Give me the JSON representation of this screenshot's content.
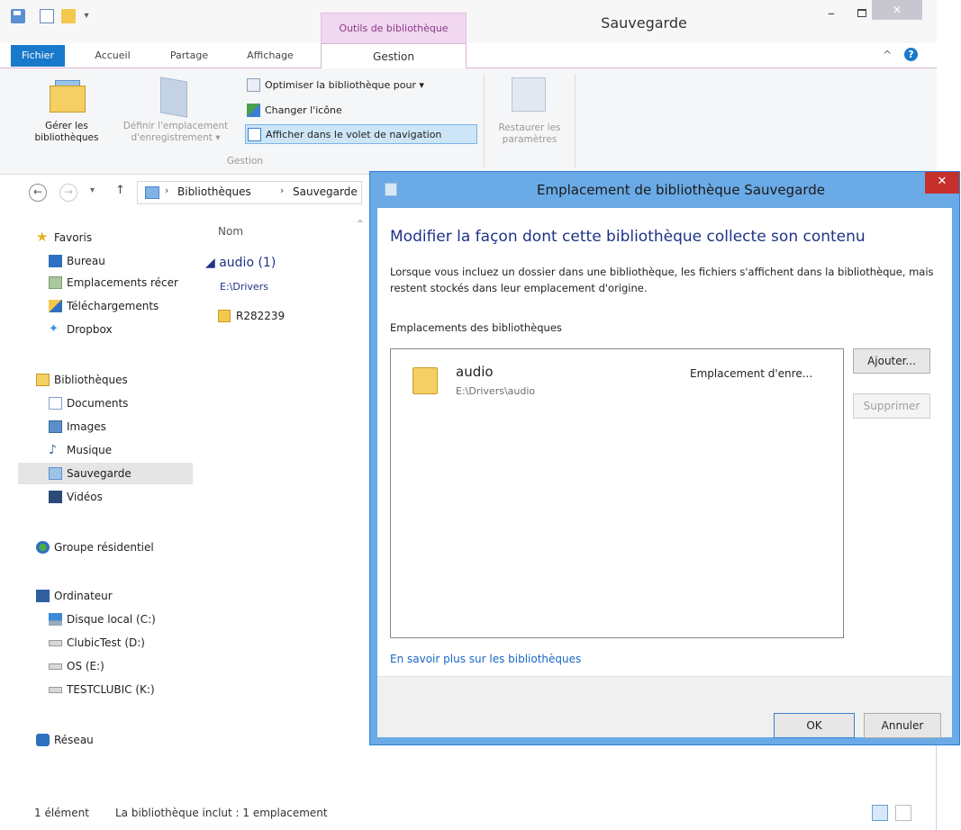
{
  "window": {
    "title": "Sauvegarde",
    "contextual_tab_header": "Outils de bibliothèque",
    "minimize": "–",
    "close": "✕"
  },
  "tabs": {
    "fichier": "Fichier",
    "accueil": "Accueil",
    "partage": "Partage",
    "affichage": "Affichage",
    "gestion": "Gestion"
  },
  "ribbon": {
    "collapse": "^",
    "help": "?",
    "manage_libraries": "Gérer les\nbibliothèques",
    "set_save_location": "Définir l'emplacement\nd'enregistrement ▾",
    "optimize": "Optimiser la bibliothèque pour ▾",
    "change_icon": "Changer l'icône",
    "show_in_nav": "Afficher dans le volet de navigation",
    "group_label": "Gestion",
    "restore": "Restaurer les\nparamètres"
  },
  "address": {
    "back": "←",
    "forward": "→",
    "history": "▾",
    "up": "↑",
    "sep": "›",
    "crumb1": "Bibliothèques",
    "crumb2": "Sauvegarde"
  },
  "nav": {
    "favorites": "Favoris",
    "bureau": "Bureau",
    "emplacements": "Emplacements récer",
    "telechargements": "Téléchargements",
    "dropbox": "Dropbox",
    "libraries": "Bibliothèques",
    "documents": "Documents",
    "images": "Images",
    "musique": "Musique",
    "sauvegarde": "Sauvegarde",
    "videos": "Vidéos",
    "homegroup": "Groupe résidentiel",
    "computer": "Ordinateur",
    "drive_c": "Disque local (C:)",
    "drive_d": "ClubicTest (D:)",
    "drive_e": "OS (E:)",
    "drive_k": "TESTCLUBIC (K:)",
    "network": "Réseau"
  },
  "filelist": {
    "col_name": "Nom",
    "sort_arrow": "^",
    "group_header": "◢ audio (1)",
    "group_path": "E:\\Drivers",
    "file_name": "R282239"
  },
  "status": {
    "count": "1 élément",
    "info": "La bibliothèque inclut : 1 emplacement"
  },
  "dialog": {
    "title": "Emplacement de bibliothèque Sauvegarde",
    "close": "✕",
    "heading": "Modifier la façon dont cette bibliothèque collecte son contenu",
    "description": "Lorsque vous incluez un dossier dans une bibliothèque, les fichiers s'affichent dans la bibliothèque, mais restent stockés dans leur emplacement d'origine.",
    "locations_label": "Emplacements des bibliothèques",
    "location_name": "audio",
    "location_path": "E:\\Drivers\\audio",
    "location_status": "Emplacement d'enre...",
    "add_button": "Ajouter...",
    "remove_button": "Supprimer",
    "learn_more": "En savoir plus sur les bibliothèques",
    "ok_button": "OK",
    "cancel_button": "Annuler"
  },
  "colors": {
    "accent": "#1979ca",
    "contextual": "#f1d7ef",
    "dialog_frame": "#6aaae6",
    "dialog_close": "#c6302c",
    "link": "#1767c6",
    "heading": "#1e3287"
  }
}
